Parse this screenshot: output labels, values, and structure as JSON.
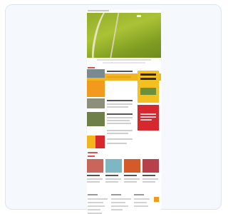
{
  "page": {
    "title": "",
    "hero_alt": "",
    "colors": {
      "card_background": "#f5f8fc",
      "card_border": "#dde6f0",
      "accent_yellow": "#f4c020",
      "accent_red": "#d8282f",
      "accent_orange": "#f29a1e",
      "hero_green": "#93ad2c"
    }
  }
}
